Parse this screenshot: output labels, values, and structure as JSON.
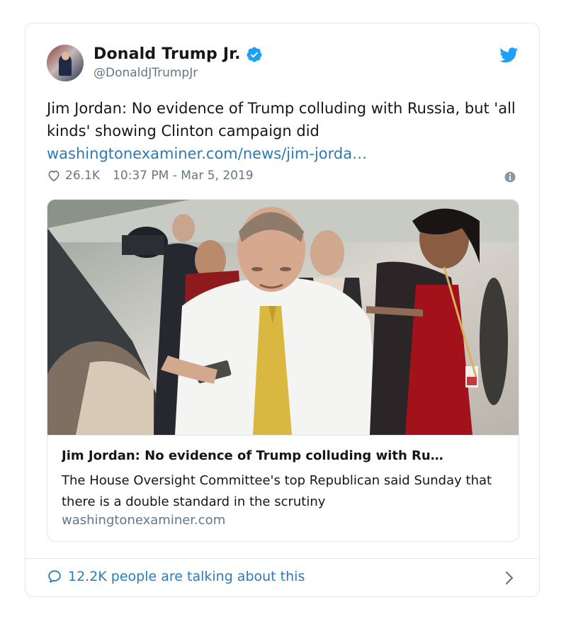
{
  "tweet": {
    "author": {
      "display_name": "Donald Trump Jr.",
      "handle": "@DonaldJTrumpJr",
      "verified": true
    },
    "text": "Jim Jordan: No evidence of Trump colluding with Russia, but 'all kinds' showing Clinton campaign did",
    "link": "washingtonexaminer.com/news/jim-jorda…",
    "likes": "26.1K",
    "timestamp": "10:37 PM - Mar 5, 2019"
  },
  "link_card": {
    "title": "Jim Jordan: No evidence of Trump colluding with Ru…",
    "description": "The House Oversight Committee's top Republican said Sunday that there is a double standard in the scrutiny",
    "domain": "washingtonexaminer.com"
  },
  "footer": {
    "conversation_text": "12.2K people are talking about this"
  },
  "icons": {
    "verified": "verified-badge-icon",
    "brand": "twitter-bird-icon",
    "like": "heart-icon",
    "info": "info-icon",
    "conversation": "speech-bubble-icon",
    "more": "chevron-right-icon"
  },
  "colors": {
    "brand_blue": "#1da1f2",
    "link_blue": "#2b7bb9",
    "secondary_text": "#657786",
    "border": "#e1e8ed"
  }
}
